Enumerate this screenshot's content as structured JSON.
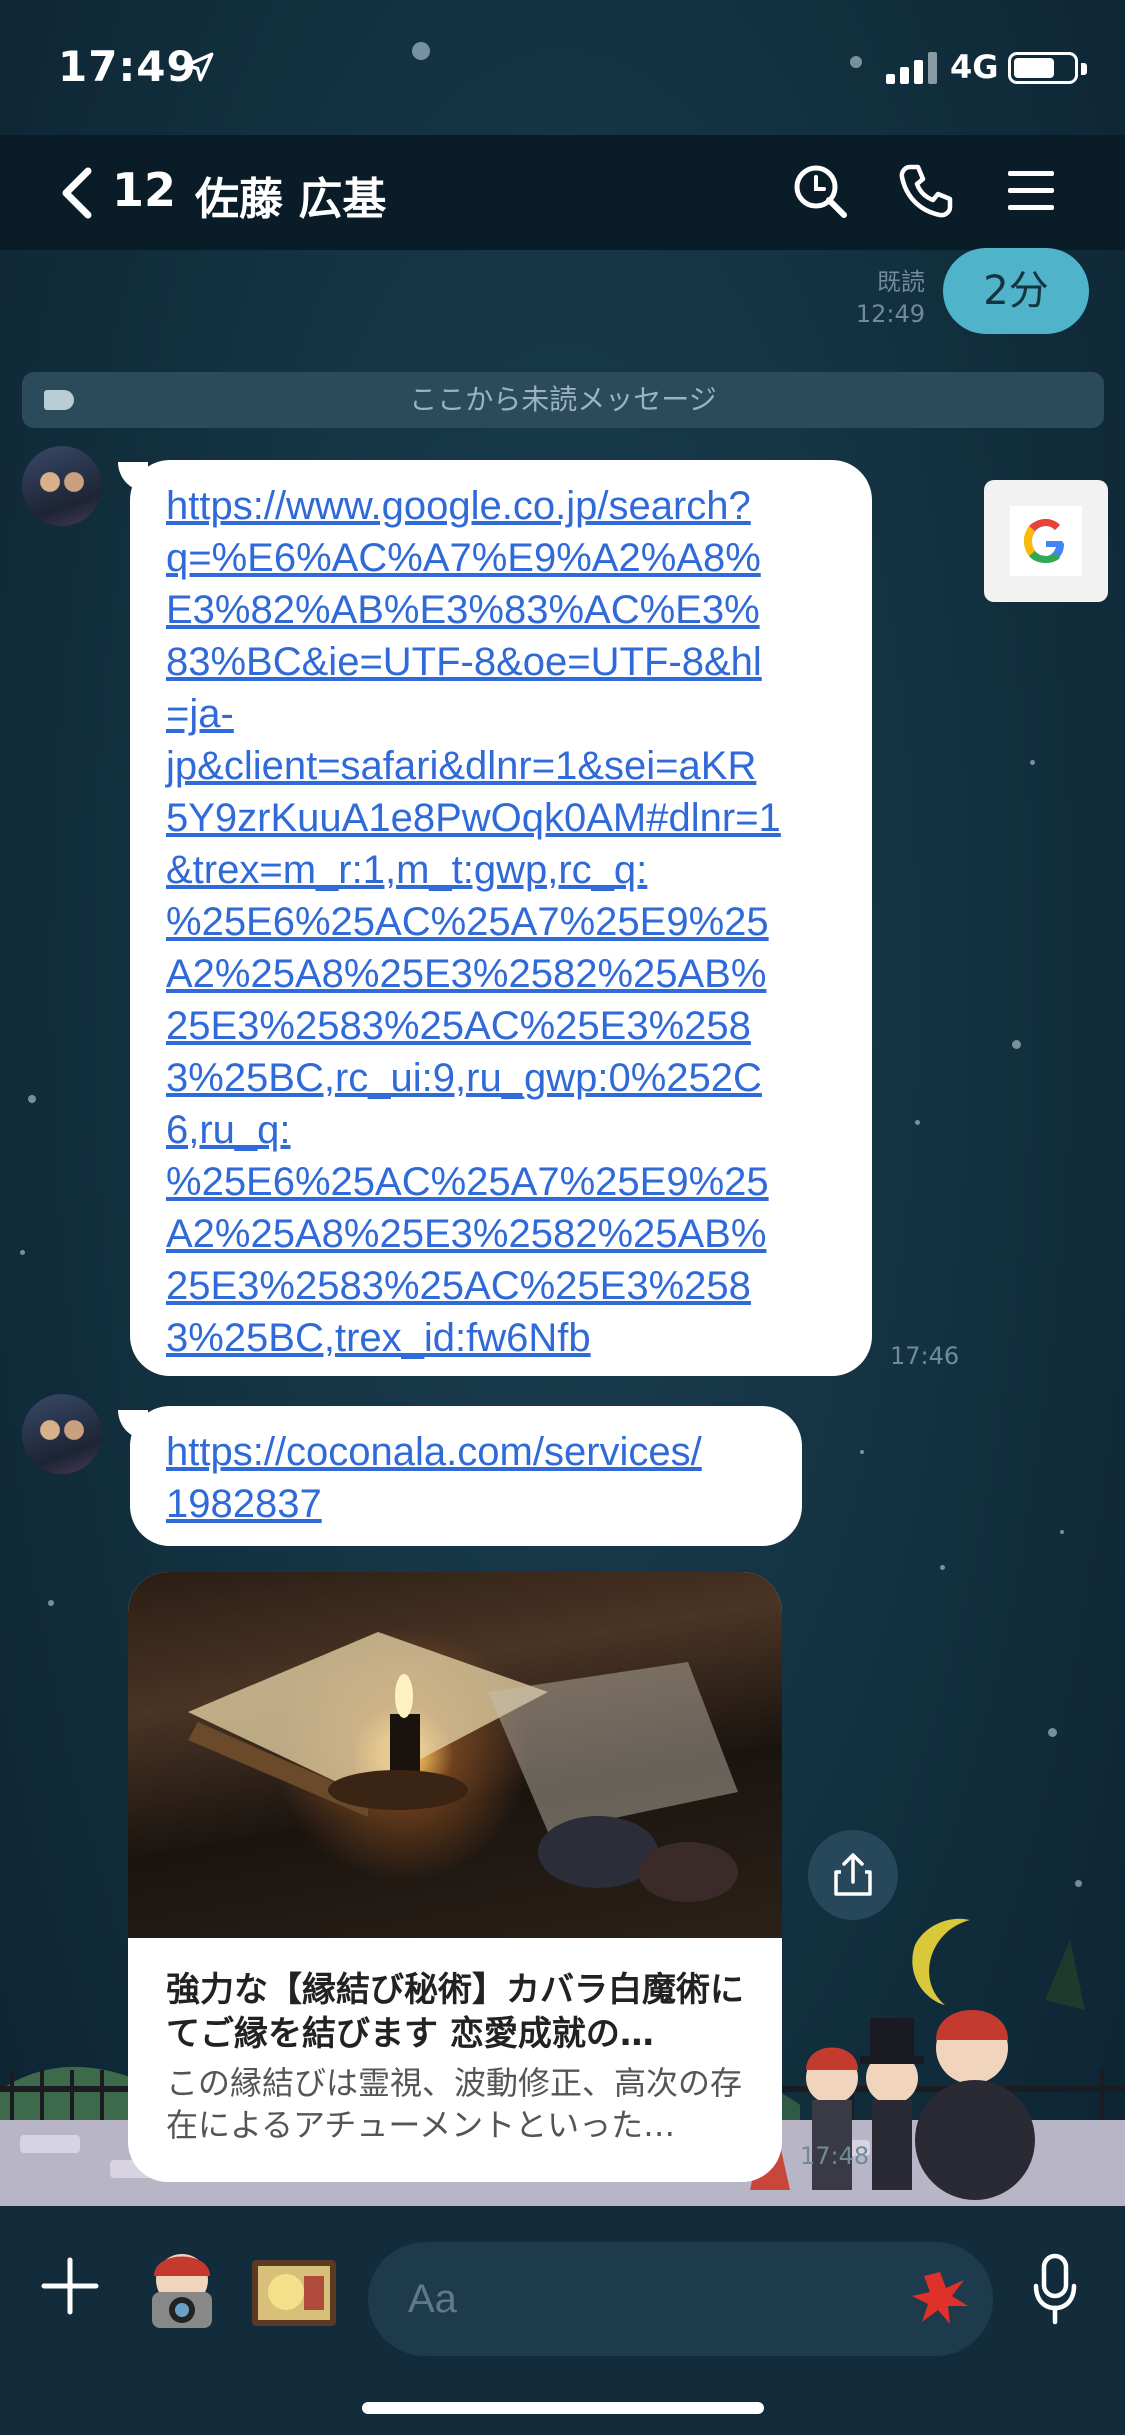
{
  "status_bar": {
    "time": "17:49",
    "network": "4G"
  },
  "header": {
    "unread_count": "12",
    "title": "佐藤 広基"
  },
  "sent_message": {
    "read_label": "既読",
    "time": "12:49",
    "text": "2分"
  },
  "unread_divider": {
    "text": "ここから未読メッセージ"
  },
  "messages": [
    {
      "link": "https://www.google.co.jp/search?q=%E6%AC%A7%E9%A2%A8%E3%82%AB%E3%83%AC%E3%83%BC&ie=UTF-8&oe=UTF-8&hl=ja-jp&client=safari&dlnr=1&sei=aKR5Y9zrKuuA1e8PwOqk0AM#dlnr=1&trex=m_r:1,m_t:gwp,rc_q:%25E6%25AC%25A7%25E9%25A2%25A8%25E3%2582%25AB%25E3%2583%25AC%25E3%2583%25BC,rc_ui:9,ru_gwp:0%252C6,ru_q:%25E6%25AC%25A7%25E9%25A2%25A8%25E3%2582%25AB%25E3%2583%25AC%25E3%2583%25BC,trex_id:fw6Nfb",
      "link_lines": [
        "https://www.google.co.jp/search?",
        "q=%E6%AC%A7%E9%A2%A8%",
        "E3%82%AB%E3%83%AC%E3%",
        "83%BC&ie=UTF-8&oe=UTF-8&hl",
        "=ja-",
        "jp&client=safari&dlnr=1&sei=aKR",
        "5Y9zrKuuA1e8PwOqk0AM#dlnr=1",
        "&trex=m_r:1,m_t:gwp,rc_q:",
        "%25E6%25AC%25A7%25E9%25",
        "A2%25A8%25E3%2582%25AB%",
        "25E3%2583%25AC%25E3%258",
        "3%25BC,rc_ui:9,ru_gwp:0%252C",
        "6,ru_q:",
        "%25E6%25AC%25A7%25E9%25",
        "A2%25A8%25E3%2582%25AB%",
        "25E3%2583%25AC%25E3%258",
        "3%25BC,trex_id:fw6Nfb"
      ],
      "time": "17:46"
    },
    {
      "link_lines": [
        "https://coconala.com/services/",
        "1982837"
      ],
      "time": ""
    }
  ],
  "link_card": {
    "title": "強力な【縁結び秘術】カバラ白魔術にてご縁を結びます 恋愛成就の…",
    "description": "この縁結びは霊視、波動修正、高次の存在によるアチューメントといった…",
    "time": "17:48"
  },
  "input": {
    "placeholder": "Aa"
  },
  "icons": {
    "back": "chevron-left-icon",
    "search": "search-icon",
    "call": "phone-icon",
    "menu": "hamburger-icon",
    "google": "google-logo-icon",
    "share": "share-icon",
    "plus": "plus-icon",
    "mic": "microphone-icon",
    "location": "location-arrow-icon",
    "signal": "signal-bars-icon",
    "battery": "battery-icon"
  },
  "colors": {
    "accent_bubble": "#4fb3c9",
    "link": "#2f6ad8",
    "header_bg": "#0a1c28",
    "background": "#12303f"
  }
}
